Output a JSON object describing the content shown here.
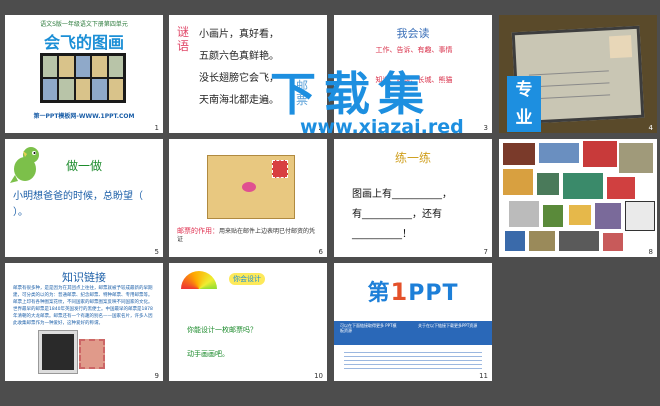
{
  "slides": [
    {
      "num": "1",
      "top": "语文S版一年级语文下册第四单元",
      "title": "会飞的图画",
      "footer": "第一PPT模板网-WWW.1PPT.COM"
    },
    {
      "num": "2",
      "side": "谜语",
      "lines": [
        "小画片，真好看，",
        "五颜六色真鲜艳。",
        "没长翅膀它会飞，",
        "天南海北都走遍。"
      ],
      "answer": "邮票"
    },
    {
      "num": "3",
      "title": "我会读",
      "words": [
        "工作、告诉、有趣、事情",
        "知道、建筑、长城、熊猫"
      ]
    },
    {
      "num": "4"
    },
    {
      "num": "5",
      "title": "做一做",
      "text": "小明想爸爸的时候，总盼望（ ）。"
    },
    {
      "num": "6",
      "caption_red": "邮票的作用：",
      "caption": "用来贴在邮件上边表明已付邮资的凭证"
    },
    {
      "num": "7",
      "title": "练一练",
      "lines": [
        "图画上有__________，",
        "有__________，还有",
        "__________！"
      ]
    },
    {
      "num": "8"
    },
    {
      "num": "9",
      "title": "知识链接",
      "text": "邮票有很多种，是是因为在其团点上往往，邮票就被予较成最新的早期建，可分类的以的为：普通邮票、纪念邮票、特种邮票、专用邮票等。邮票上印有各种图案花纹，不同国家的邮票图案反映不同国家的文化。世界最早的邮票是1840年英国发行的黑便士。中国最早的邮票是1878年清朝的大龙邮票。邮票还有一个有趣的别名——国家名片，许多人因此收集邮票作为一种爱好，这种爱好的称谓。"
    },
    {
      "num": "10",
      "tag": "你会设计",
      "lines": [
        "你能设计一枚邮票吗？",
        "动手画画吧。"
      ]
    },
    {
      "num": "11",
      "logo_a": "第",
      "logo_one": "1",
      "logo_b": "PPT",
      "band_left": "可以在下面链接取得更多 PPT模板资源",
      "band_right": "关于在以下链接下载更多PPT资源"
    }
  ],
  "watermark": {
    "big": "下载集",
    "url": "www.xiazai.red",
    "badge": [
      "专",
      "业"
    ]
  },
  "colors": {
    "background": "#4d4d4d",
    "accent": "#1d8fe0",
    "red": "#e03050",
    "green": "#1a8a2a"
  }
}
